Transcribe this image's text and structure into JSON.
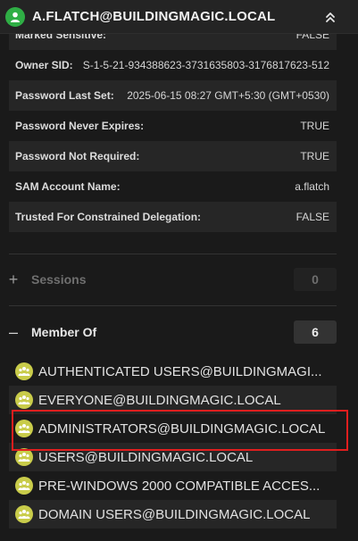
{
  "header": {
    "title": "A.FLATCH@BUILDINGMAGIC.LOCAL",
    "user_icon": "user-icon",
    "collapse_icon": "chevrons-up-icon"
  },
  "properties": [
    {
      "key": "Marked Sensitive:",
      "value": "FALSE"
    },
    {
      "key": "Owner SID:",
      "value": "S-1-5-21-934388623-3731635803-3176817623-512"
    },
    {
      "key": "Password Last Set:",
      "value": "2025-06-15 08:27 GMT+5:30 (GMT+0530)"
    },
    {
      "key": "Password Never Expires:",
      "value": "TRUE"
    },
    {
      "key": "Password Not Required:",
      "value": "TRUE"
    },
    {
      "key": "SAM Account Name:",
      "value": "a.flatch"
    },
    {
      "key": "Trusted For Constrained Delegation:",
      "value": "FALSE"
    }
  ],
  "sessions": {
    "toggle": "+",
    "label": "Sessions",
    "count": "0"
  },
  "member_of": {
    "toggle": "–",
    "label": "Member Of",
    "count": "6"
  },
  "groups": [
    {
      "label": "AUTHENTICATED USERS@BUILDINGMAGI..."
    },
    {
      "label": "EVERYONE@BUILDINGMAGIC.LOCAL"
    },
    {
      "label": "ADMINISTRATORS@BUILDINGMAGIC.LOCAL"
    },
    {
      "label": "USERS@BUILDINGMAGIC.LOCAL"
    },
    {
      "label": "PRE-WINDOWS 2000 COMPATIBLE ACCES..."
    },
    {
      "label": "DOMAIN USERS@BUILDINGMAGIC.LOCAL"
    }
  ],
  "colors": {
    "background": "#1a1a1a",
    "user_icon": "#2fae45",
    "group_icon": "#c9cc4a",
    "highlight": "#e01e1e"
  }
}
